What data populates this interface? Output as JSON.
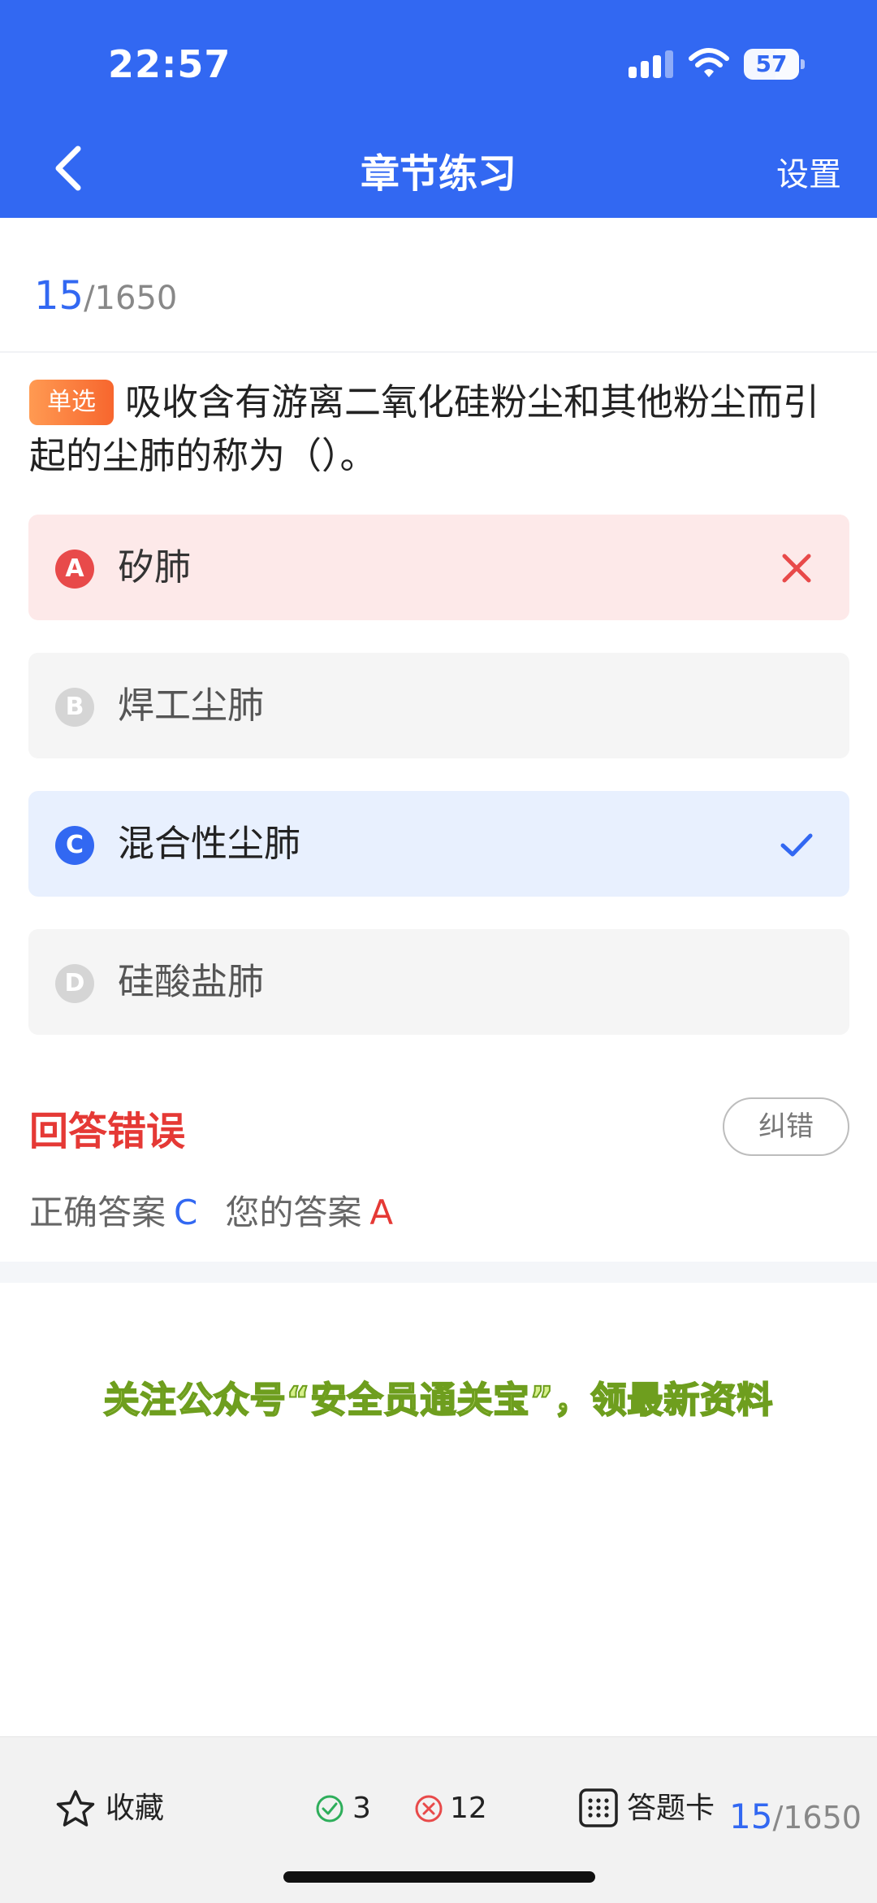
{
  "status": {
    "time": "22:57",
    "battery": "57"
  },
  "nav": {
    "title": "章节练习",
    "settings": "设置"
  },
  "progress": {
    "current": "15",
    "total": "/1650"
  },
  "question": {
    "type_badge": "单选",
    "text": "吸收含有游离二氧化硅粉尘和其他粉尘而引起的尘肺的称为（）。"
  },
  "options": [
    {
      "letter": "A",
      "text": "矽肺",
      "state": "wrong"
    },
    {
      "letter": "B",
      "text": "焊工尘肺",
      "state": "normal"
    },
    {
      "letter": "C",
      "text": "混合性尘肺",
      "state": "correct"
    },
    {
      "letter": "D",
      "text": "硅酸盐肺",
      "state": "normal"
    }
  ],
  "result": {
    "title": "回答错误",
    "report_label": "纠错",
    "correct_label": "正确答案",
    "correct_value": "C",
    "yours_label": "您的答案",
    "yours_value": "A"
  },
  "promo_text": "关注公众号“安全员通关宝”，领最新资料",
  "bottom": {
    "favorite_label": "收藏",
    "right_count": "3",
    "wrong_count": "12",
    "card_label": "答题卡",
    "progress_current": "15",
    "progress_total": "/1650"
  },
  "colors": {
    "primary": "#3268F2",
    "error": "#E53935",
    "badge": "#F7662E",
    "promo": "#D6F08A"
  },
  "icons": [
    "back-arrow-icon",
    "signal-icon",
    "wifi-icon",
    "battery-icon",
    "cross-icon",
    "check-icon",
    "star-icon",
    "check-circle-icon",
    "cross-circle-icon",
    "grid-icon"
  ]
}
